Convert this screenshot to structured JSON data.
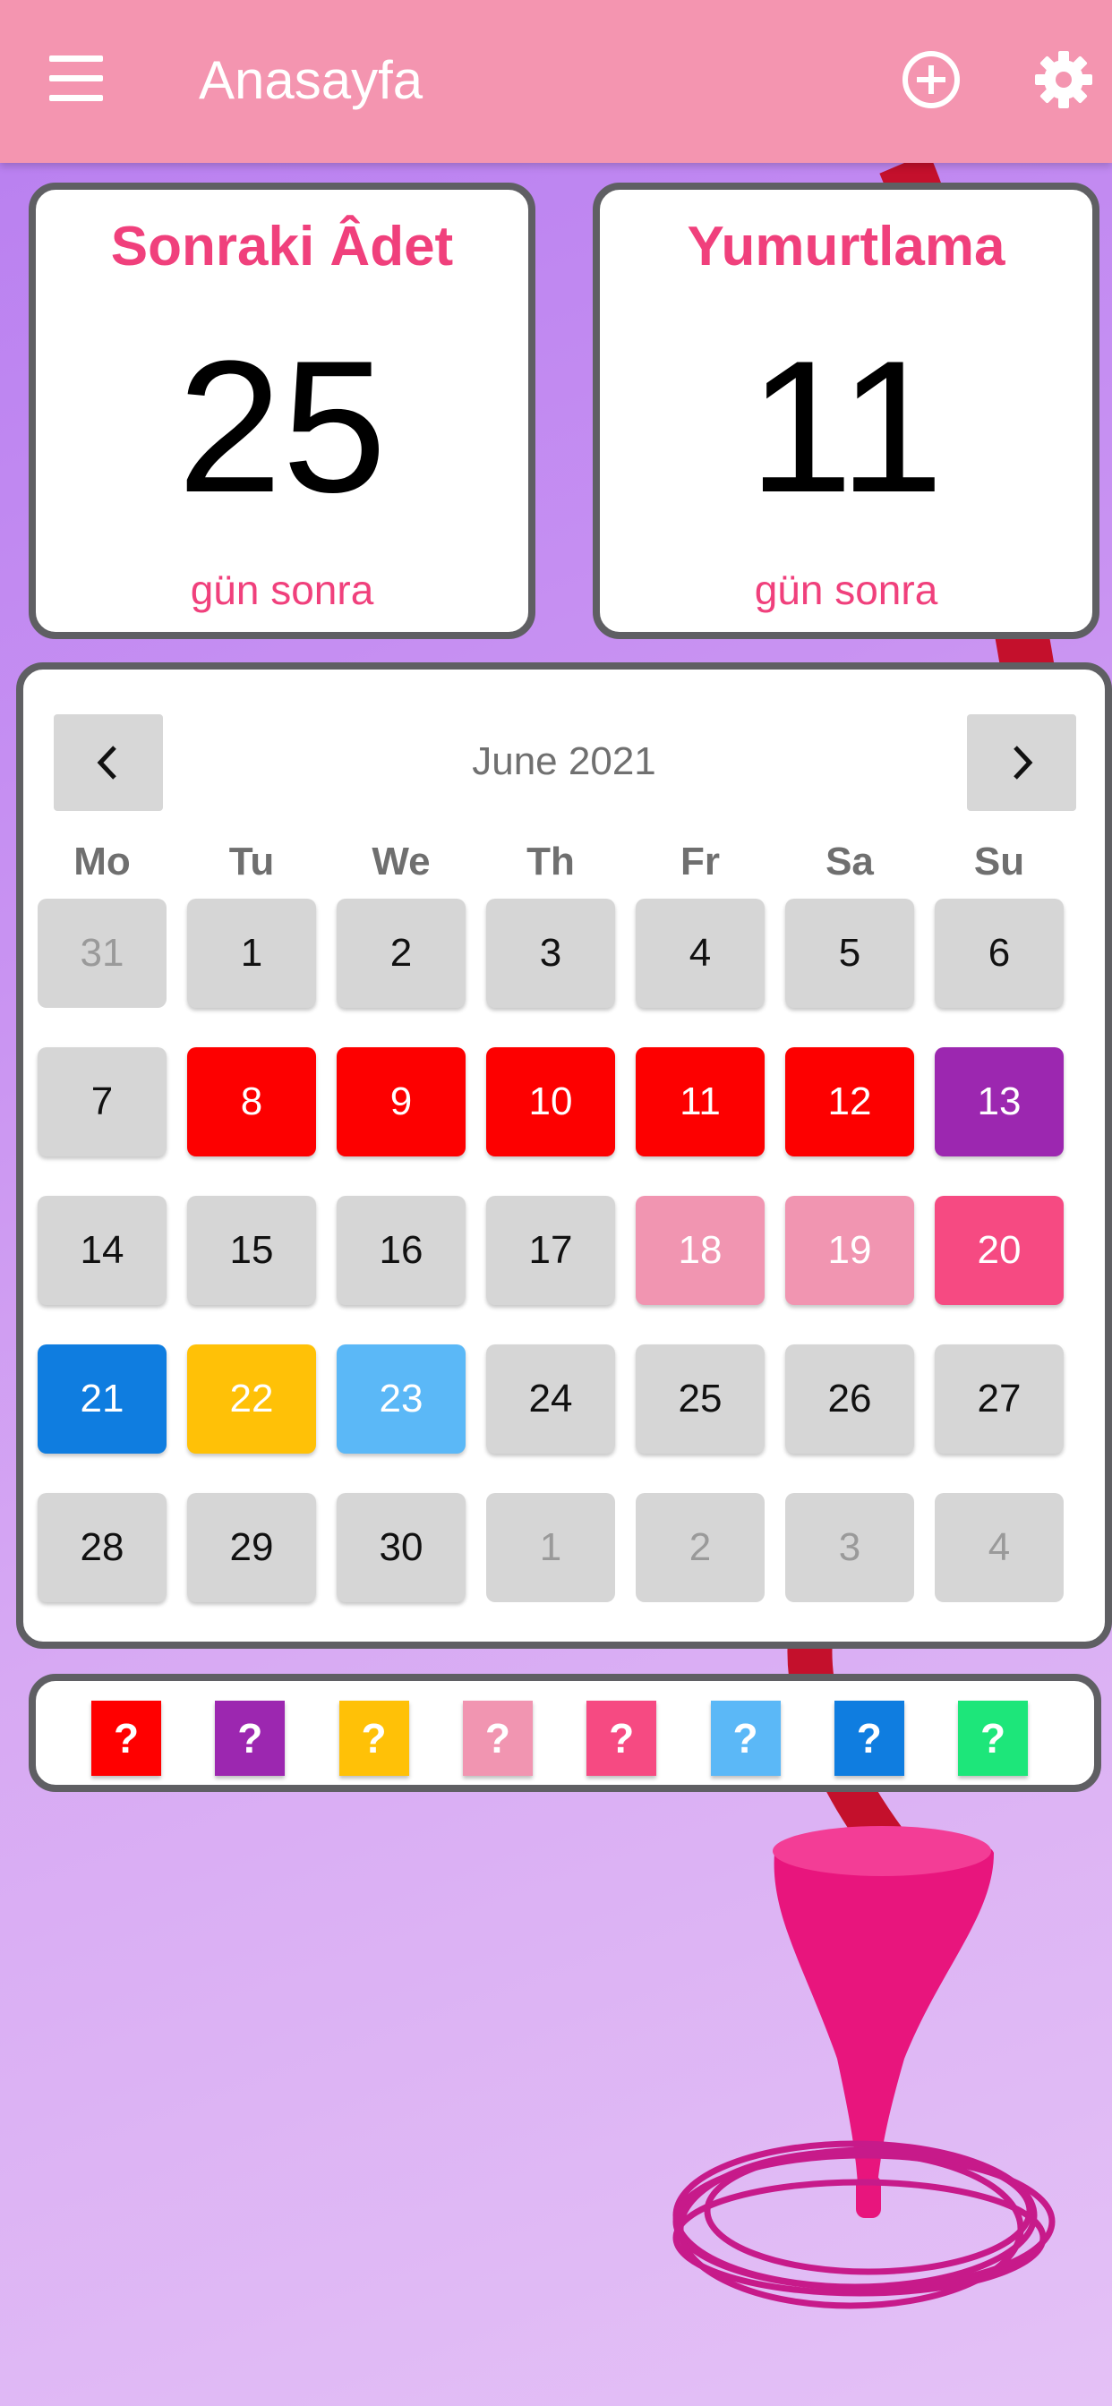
{
  "app_bar": {
    "title": "Anasayfa",
    "icons": {
      "menu": "menu-icon",
      "add": "add-circle-icon",
      "settings": "gear-icon"
    }
  },
  "cards": [
    {
      "title": "Sonraki Âdet",
      "value": "25",
      "unit": "gün sonra"
    },
    {
      "title": "Yumurtlama",
      "value": "11",
      "unit": "gün sonra"
    }
  ],
  "calendar": {
    "month_title": "June 2021",
    "weekdays": [
      "Mo",
      "Tu",
      "We",
      "Th",
      "Fr",
      "Sa",
      "Su"
    ],
    "weeks": [
      [
        {
          "day": "31",
          "muted": true
        },
        {
          "day": "1"
        },
        {
          "day": "2"
        },
        {
          "day": "3"
        },
        {
          "day": "4"
        },
        {
          "day": "5"
        },
        {
          "day": "6"
        }
      ],
      [
        {
          "day": "7"
        },
        {
          "day": "8",
          "color": "#fd0000"
        },
        {
          "day": "9",
          "color": "#fd0000"
        },
        {
          "day": "10",
          "color": "#fd0000"
        },
        {
          "day": "11",
          "color": "#fd0000"
        },
        {
          "day": "12",
          "color": "#fd0000"
        },
        {
          "day": "13",
          "color": "#9c27b0"
        }
      ],
      [
        {
          "day": "14"
        },
        {
          "day": "15"
        },
        {
          "day": "16"
        },
        {
          "day": "17"
        },
        {
          "day": "18",
          "color": "#f195b1"
        },
        {
          "day": "19",
          "color": "#f195b1"
        },
        {
          "day": "20",
          "color": "#f64a82"
        }
      ],
      [
        {
          "day": "21",
          "color": "#0f7de0"
        },
        {
          "day": "22",
          "color": "#ffc107"
        },
        {
          "day": "23",
          "color": "#5bb8f7"
        },
        {
          "day": "24"
        },
        {
          "day": "25"
        },
        {
          "day": "26"
        },
        {
          "day": "27"
        }
      ],
      [
        {
          "day": "28"
        },
        {
          "day": "29"
        },
        {
          "day": "30"
        },
        {
          "day": "1",
          "muted": true
        },
        {
          "day": "2",
          "muted": true
        },
        {
          "day": "3",
          "muted": true
        },
        {
          "day": "4",
          "muted": true
        }
      ]
    ]
  },
  "legend": {
    "chips": [
      {
        "label": "?",
        "color": "#ff0000"
      },
      {
        "label": "?",
        "color": "#9c27b0"
      },
      {
        "label": "?",
        "color": "#ffc107"
      },
      {
        "label": "?",
        "color": "#f195b1"
      },
      {
        "label": "?",
        "color": "#f64a82"
      },
      {
        "label": "?",
        "color": "#5bb8f7"
      },
      {
        "label": "?",
        "color": "#0f7de0"
      },
      {
        "label": "?",
        "color": "#1de67a"
      }
    ]
  },
  "colors": {
    "app_bar": "#f495b0",
    "accent_text": "#f0407c",
    "card_border": "#5f5f63",
    "day_default": "#d6d6d6"
  }
}
